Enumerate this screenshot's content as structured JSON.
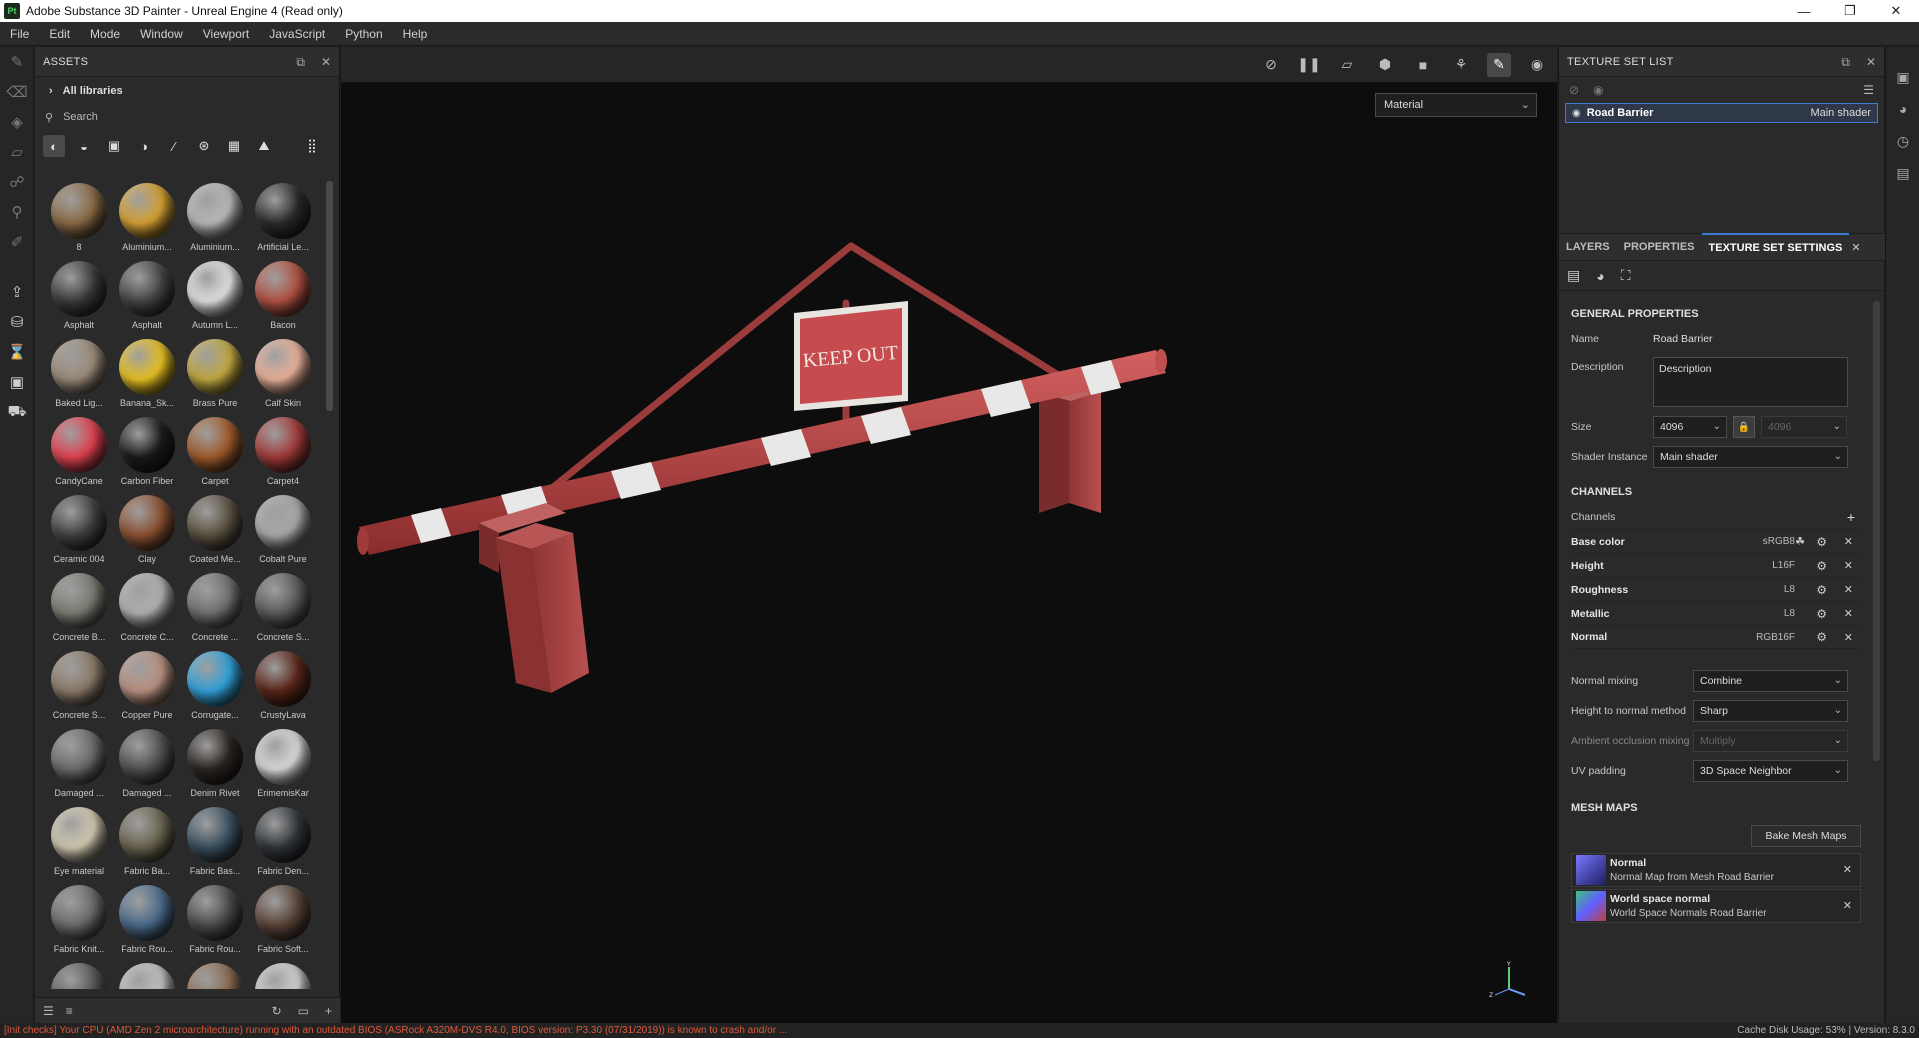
{
  "window": {
    "app_logo": "Pt",
    "title": "Adobe Substance 3D Painter - Unreal Engine 4 (Read only)",
    "controls": [
      "—",
      "❐",
      "✕"
    ]
  },
  "menu": [
    "File",
    "Edit",
    "Mode",
    "Window",
    "Viewport",
    "JavaScript",
    "Python",
    "Help"
  ],
  "left_tools": [
    "paint-brush-icon",
    "eraser-icon",
    "projection-icon",
    "polygon-fill-icon",
    "smudge-icon",
    "clone-icon",
    "color-picker-icon",
    "export-icon",
    "bake-icon",
    "iray-icon",
    "layer-stack-icon",
    "camera-icon"
  ],
  "assets": {
    "title": "ASSETS",
    "libraries_label": "All libraries",
    "search_placeholder": "Search",
    "filter_icons": [
      "materials-filter-icon",
      "smart-materials-filter-icon",
      "masks-filter-icon",
      "generators-filter-icon",
      "brushes-filter-icon",
      "particles-filter-icon",
      "textures-filter-icon",
      "environments-filter-icon"
    ],
    "items": [
      {
        "label": "8",
        "color": "#8a6a45"
      },
      {
        "label": "Aluminium...",
        "color": "#d4a032"
      },
      {
        "label": "Aluminium...",
        "color": "#b8b8b8"
      },
      {
        "label": "Artificial Le...",
        "color": "#2a2a2a"
      },
      {
        "label": "Asphalt",
        "color": "#3a3a3a"
      },
      {
        "label": "Asphalt",
        "color": "#444444"
      },
      {
        "label": "Autumn L...",
        "color": "#e0e0e0"
      },
      {
        "label": "Bacon",
        "color": "#b05040"
      },
      {
        "label": "Baked Lig...",
        "color": "#9a8a78"
      },
      {
        "label": "Banana_Sk...",
        "color": "#e6c020"
      },
      {
        "label": "Brass Pure",
        "color": "#c0a840"
      },
      {
        "label": "Calf Skin",
        "color": "#e8b098"
      },
      {
        "label": "CandyCane",
        "color": "#e04050"
      },
      {
        "label": "Carbon Fiber",
        "color": "#1a1a1a"
      },
      {
        "label": "Carpet",
        "color": "#a05a2a"
      },
      {
        "label": "Carpet4",
        "color": "#a03838"
      },
      {
        "label": "Ceramic 004",
        "color": "#404040"
      },
      {
        "label": "Clay",
        "color": "#8a5030"
      },
      {
        "label": "Coated Me...",
        "color": "#5a5040"
      },
      {
        "label": "Cobalt Pure",
        "color": "#a8a8a8"
      },
      {
        "label": "Concrete B...",
        "color": "#7a7a72"
      },
      {
        "label": "Concrete C...",
        "color": "#b0b0b0"
      },
      {
        "label": "Concrete ...",
        "color": "#707070"
      },
      {
        "label": "Concrete S...",
        "color": "#5a5a5a"
      },
      {
        "label": "Concrete S...",
        "color": "#8a7a68"
      },
      {
        "label": "Copper Pure",
        "color": "#b89080"
      },
      {
        "label": "Corrugate...",
        "color": "#30a0d8"
      },
      {
        "label": "CrustyLava",
        "color": "#5a2418"
      },
      {
        "label": "Damaged ...",
        "color": "#6a6a6a"
      },
      {
        "label": "Damaged ...",
        "color": "#505050"
      },
      {
        "label": "Denim Rivet",
        "color": "#2a2420"
      },
      {
        "label": "ErimemisKar",
        "color": "#d8d8d8"
      },
      {
        "label": "Eye material",
        "color": "#d0c8b0"
      },
      {
        "label": "Fabric Ba...",
        "color": "#6a6450"
      },
      {
        "label": "Fabric Bas...",
        "color": "#3a5060"
      },
      {
        "label": "Fabric Den...",
        "color": "#30343a"
      },
      {
        "label": "Fabric Knit...",
        "color": "#6a6a6a"
      },
      {
        "label": "Fabric Rou...",
        "color": "#4a6a8a"
      },
      {
        "label": "Fabric Rou...",
        "color": "#4a4a4a"
      },
      {
        "label": "Fabric Soft...",
        "color": "#5a4438"
      },
      {
        "label": "",
        "color": "#5a5a5a"
      },
      {
        "label": "",
        "color": "#c0c0c0"
      },
      {
        "label": "",
        "color": "#8a6a50"
      },
      {
        "label": "",
        "color": "#d0d0d0"
      }
    ],
    "footer_icons": [
      "filter-icon",
      "sort-icon",
      "refresh-icon",
      "folder-icon",
      "add-icon"
    ]
  },
  "viewport": {
    "tools": [
      "hide-icon",
      "pause-icon",
      "2d-view-icon",
      "3d-view-icon",
      "camera-icon",
      "symmetry-icon",
      "paint-mode-icon",
      "screenshot-icon"
    ],
    "material_mode": "Material",
    "sign_text": "KEEP OUT"
  },
  "texture_set_list": {
    "title": "TEXTURE SET LIST",
    "row": {
      "name": "Road Barrier",
      "shader": "Main shader"
    }
  },
  "tabs": {
    "items": [
      "LAYERS",
      "PROPERTIES",
      "TEXTURE SET SETTINGS"
    ],
    "active": "TEXTURE SET SETTINGS"
  },
  "tss": {
    "general_title": "GENERAL PROPERTIES",
    "name_label": "Name",
    "name_value": "Road Barrier",
    "description_label": "Description",
    "description_value": "Description",
    "size_label": "Size",
    "size_value": "4096",
    "size_value_locked": "4096",
    "shader_instance_label": "Shader Instance",
    "shader_instance_value": "Main shader",
    "channels_title": "CHANNELS",
    "channels_label": "Channels",
    "channels": [
      {
        "name": "Base color",
        "format": "sRGB8"
      },
      {
        "name": "Height",
        "format": "L16F"
      },
      {
        "name": "Roughness",
        "format": "L8"
      },
      {
        "name": "Metallic",
        "format": "L8"
      },
      {
        "name": "Normal",
        "format": "RGB16F"
      }
    ],
    "normal_mixing_label": "Normal mixing",
    "normal_mixing_value": "Combine",
    "height_to_normal_label": "Height to normal method",
    "height_to_normal_value": "Sharp",
    "ao_mixing_label": "Ambient occlusion mixing",
    "ao_mixing_value": "Multiply",
    "uv_padding_label": "UV padding",
    "uv_padding_value": "3D Space Neighbor",
    "mesh_maps_title": "MESH MAPS",
    "bake_button": "Bake Mesh Maps",
    "mesh_maps": [
      {
        "name": "Normal",
        "desc": "Normal Map from Mesh Road Barrier"
      },
      {
        "name": "World space normal",
        "desc": "World Space Normals Road Barrier"
      }
    ]
  },
  "right_strip_icons": [
    "display-settings-icon",
    "shader-settings-icon",
    "history-icon",
    "log-icon"
  ],
  "status": {
    "warning": "[Init checks] Your CPU (AMD Zen 2 microarchitecture) running with an outdated BIOS (ASRock A320M-DVS R4.0, BIOS version: P3.30 (07/31/2019)) is known to crash and/or ...",
    "right": "Cache Disk Usage:   53% | Version: 8.3.0"
  },
  "colors": {
    "accent": "#3b7bd1",
    "warning": "#e05a3a",
    "barrier_red": "#b84a48"
  }
}
